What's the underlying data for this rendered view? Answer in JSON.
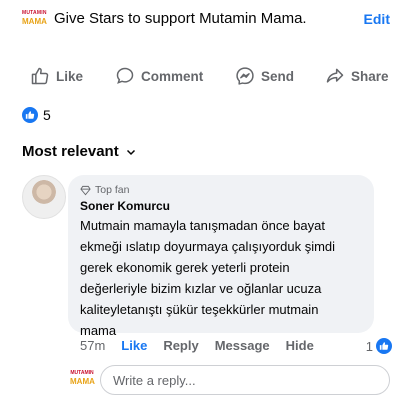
{
  "post": {
    "brand_logo": {
      "line1": "MUTAMIN",
      "line2": "MAMA"
    },
    "title": "Give Stars to support Mutamin Mama.",
    "edit_label": "Edit"
  },
  "actions": {
    "like": "Like",
    "comment": "Comment",
    "send": "Send",
    "share": "Share"
  },
  "reactions": {
    "count": "5"
  },
  "comments_sort": "Most relevant",
  "comment": {
    "badge": "Top fan",
    "author": "Soner Komurcu",
    "text": "Mutmain mamayla tanışmadan önce bayat\nekmeği ıslatıp doyurmaya çalışıyorduk şimdi\ngerek ekonomik gerek yeterli protein\ndeğerleriyle bizim kızlar ve oğlanlar ucuza\nkaliteyletanıştı şükür teşekkürler mutmain\nmama",
    "time": "57m",
    "like": "Like",
    "reply": "Reply",
    "message": "Message",
    "hide": "Hide",
    "like_count": "1"
  },
  "reply_box": {
    "placeholder": "Write a reply..."
  },
  "colors": {
    "accent": "#1877f2",
    "bubble": "#f0f2f5",
    "muted": "#65676b"
  }
}
